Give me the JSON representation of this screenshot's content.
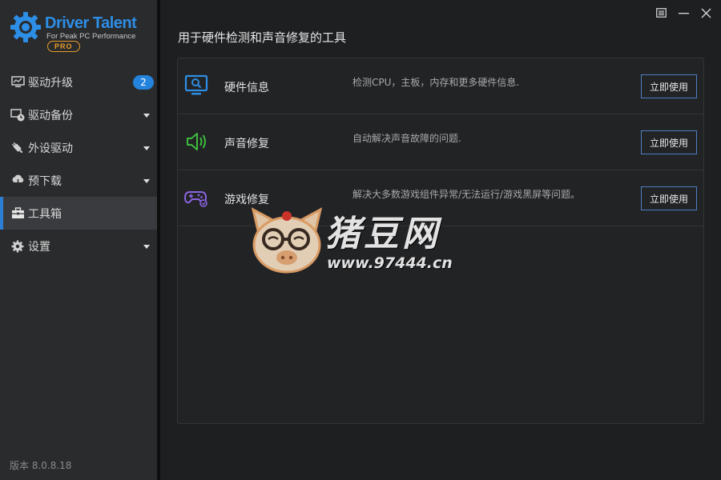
{
  "app": {
    "logo_title": "Driver Talent",
    "logo_subtitle": "For Peak PC Performance",
    "logo_badge": "PRO",
    "version": "版本 8.0.8.18"
  },
  "sidebar": {
    "items": [
      {
        "label": "驱动升级",
        "icon": "monitor-icon",
        "badge": "2"
      },
      {
        "label": "驱动备份",
        "icon": "backup-clock-icon"
      },
      {
        "label": "外设驱动",
        "icon": "usb-plug-icon"
      },
      {
        "label": "预下载",
        "icon": "cloud-download-icon"
      },
      {
        "label": "工具箱",
        "icon": "toolbox-icon",
        "active": true
      },
      {
        "label": "设置",
        "icon": "gear-icon"
      }
    ]
  },
  "window_controls": [
    "menu-icon",
    "minimize-icon",
    "close-icon"
  ],
  "main": {
    "title": "用于硬件检测和声音修复的工具",
    "tools": [
      {
        "name": "硬件信息",
        "description": "检测CPU，主板，内存和更多硬件信息.",
        "button": "立即使用",
        "icon": "hardware-search-icon",
        "color": "#2d8ee6"
      },
      {
        "name": "声音修复",
        "description": "自动解决声音故障的问题.",
        "button": "立即使用",
        "icon": "speaker-icon",
        "color": "#3dbb3d"
      },
      {
        "name": "游戏修复",
        "description": "解决大多数游戏组件异常/无法运行/游戏黑屏等问题。",
        "button": "立即使用",
        "icon": "gamepad-icon",
        "color": "#8a63e0"
      }
    ]
  },
  "watermark": {
    "text": "猪豆网",
    "url": "www.97444.cn"
  },
  "colors": {
    "accent": "#2d7fd6",
    "sidebar_bg": "#2a2b2d",
    "main_bg": "#1e1f21",
    "badge": "#2484dd"
  }
}
